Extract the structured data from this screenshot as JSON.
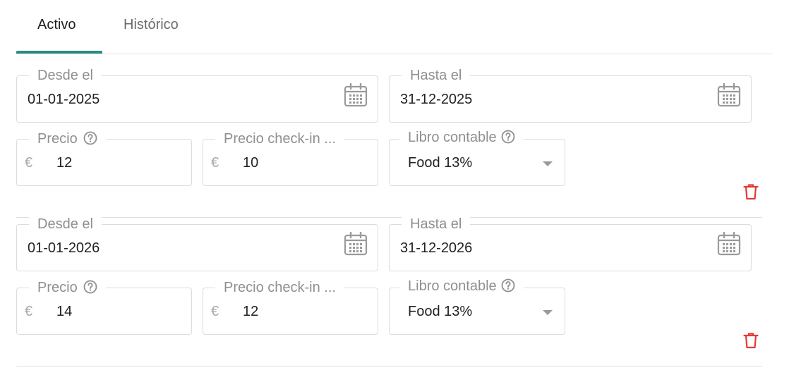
{
  "tabs": [
    {
      "label": "Activo",
      "active": true
    },
    {
      "label": "Histórico",
      "active": false
    }
  ],
  "labels": {
    "from": "Desde el",
    "to": "Hasta el",
    "price": "Precio",
    "checkin_price": "Precio check-in ...",
    "ledger": "Libro contable",
    "currency": "€"
  },
  "periods": [
    {
      "from": "01-01-2025",
      "to": "31-12-2025",
      "price": "12",
      "checkin_price": "10",
      "ledger": "Food 13%"
    },
    {
      "from": "01-01-2026",
      "to": "31-12-2026",
      "price": "14",
      "checkin_price": "12",
      "ledger": "Food 13%"
    }
  ],
  "colors": {
    "accent": "#2a8b83",
    "delete": "#e53935"
  }
}
